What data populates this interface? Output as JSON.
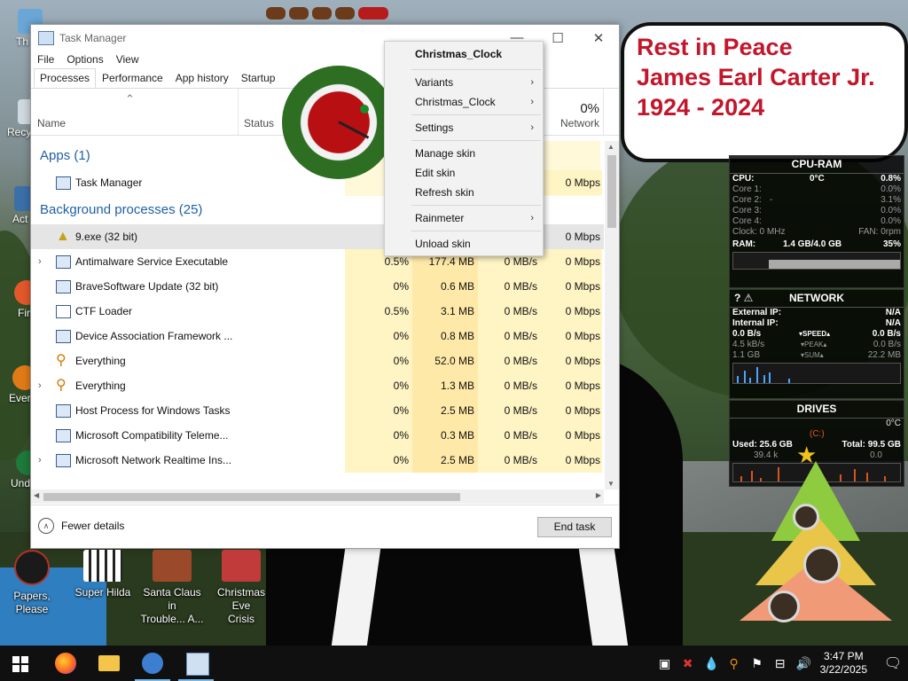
{
  "desktop": {
    "left_stubs": [
      "Th",
      "Recy",
      "Act",
      "Fir",
      "Ever",
      "Und"
    ],
    "shortcuts": [
      {
        "label_1": "Papers, Please",
        "label_2": ""
      },
      {
        "label_1": "Super Hilda",
        "label_2": ""
      },
      {
        "label_1": "Santa Claus in",
        "label_2": "Trouble... A..."
      },
      {
        "label_1": "Christmas Eve",
        "label_2": "Crisis"
      }
    ]
  },
  "task_manager": {
    "title": "Task Manager",
    "menu": [
      "File",
      "Options",
      "View"
    ],
    "tabs": [
      "Processes",
      "Performance",
      "App history",
      "Startup"
    ],
    "columns": {
      "name": "Name",
      "status": "Status",
      "network_pct": "0%",
      "network": "Network"
    },
    "groups": {
      "apps": "Apps (1)",
      "background": "Background processes (25)"
    },
    "app_rows": [
      {
        "name": "Task Manager",
        "cpu": "",
        "mem": "",
        "disk": "",
        "net": "0 Mbps"
      }
    ],
    "bg_rows": [
      {
        "name": "9.exe (32 bit)",
        "cpu": "",
        "mem": "",
        "disk": "",
        "net": "0 Mbps",
        "expand": false,
        "icon": "xmas-tree-icon"
      },
      {
        "name": "Antimalware Service Executable",
        "cpu": "0.5%",
        "mem": "177.4 MB",
        "disk": "0 MB/s",
        "net": "0 Mbps",
        "expand": true,
        "icon": "service-icon"
      },
      {
        "name": "BraveSoftware Update (32 bit)",
        "cpu": "0%",
        "mem": "0.6 MB",
        "disk": "0 MB/s",
        "net": "0 Mbps",
        "expand": false,
        "icon": "update-icon"
      },
      {
        "name": "CTF Loader",
        "cpu": "0.5%",
        "mem": "3.1 MB",
        "disk": "0 MB/s",
        "net": "0 Mbps",
        "expand": false,
        "icon": "pen-icon"
      },
      {
        "name": "Device Association Framework ...",
        "cpu": "0%",
        "mem": "0.8 MB",
        "disk": "0 MB/s",
        "net": "0 Mbps",
        "expand": false,
        "icon": "service-icon"
      },
      {
        "name": "Everything",
        "cpu": "0%",
        "mem": "52.0 MB",
        "disk": "0 MB/s",
        "net": "0 Mbps",
        "expand": false,
        "icon": "search-key-icon"
      },
      {
        "name": "Everything",
        "cpu": "0%",
        "mem": "1.3 MB",
        "disk": "0 MB/s",
        "net": "0 Mbps",
        "expand": true,
        "icon": "search-key-icon"
      },
      {
        "name": "Host Process for Windows Tasks",
        "cpu": "0%",
        "mem": "2.5 MB",
        "disk": "0 MB/s",
        "net": "0 Mbps",
        "expand": false,
        "icon": "service-icon"
      },
      {
        "name": "Microsoft Compatibility Teleme...",
        "cpu": "0%",
        "mem": "0.3 MB",
        "disk": "0 MB/s",
        "net": "0 Mbps",
        "expand": false,
        "icon": "service-icon"
      },
      {
        "name": "Microsoft Network Realtime Ins...",
        "cpu": "0%",
        "mem": "2.5 MB",
        "disk": "0 MB/s",
        "net": "0 Mbps",
        "expand": true,
        "icon": "service-icon"
      }
    ],
    "fewer_details": "Fewer details",
    "end_task": "End task"
  },
  "context_menu": {
    "header": "Christmas_Clock",
    "items": [
      {
        "label": "Variants",
        "submenu": true
      },
      {
        "label": "Christmas_Clock",
        "submenu": true
      },
      {
        "label": "Settings",
        "submenu": true
      },
      {
        "label": "Manage skin",
        "submenu": false
      },
      {
        "label": "Edit skin",
        "submenu": false
      },
      {
        "label": "Refresh skin",
        "submenu": false
      },
      {
        "label": "Rainmeter",
        "submenu": true
      },
      {
        "label": "Unload skin",
        "submenu": false
      }
    ]
  },
  "memorial": {
    "line1": "Rest in Peace",
    "line2": "James Earl Carter Jr.",
    "line3": "1924 - 2024"
  },
  "cpu_ram": {
    "title": "CPU-RAM",
    "cpu_label": "CPU:",
    "cpu_temp": "0°C",
    "cpu_pct": "0.8%",
    "cores": [
      {
        "label": "Core 1:",
        "mid": "",
        "val": "0.0%"
      },
      {
        "label": "Core 2:",
        "mid": "-",
        "val": "3.1%"
      },
      {
        "label": "Core 3:",
        "mid": "",
        "val": "0.0%"
      },
      {
        "label": "Core 4:",
        "mid": "",
        "val": "0.0%"
      }
    ],
    "clock": "Clock: 0 MHz",
    "fan": "FAN: 0rpm",
    "ram_label": "RAM:",
    "ram_val": "1.4 GB/4.0 GB",
    "ram_pct": "35%"
  },
  "network": {
    "title": "NETWORK",
    "ext_label": "External IP:",
    "ext_val": "N/A",
    "int_label": "Internal IP:",
    "int_val": "N/A",
    "rows": [
      {
        "left": "0.0 B/s",
        "mid": "▾SPEED▴",
        "right": "0.0 B/s",
        "bold": true
      },
      {
        "left": "4.5 kB/s",
        "mid": "▾PEAK▴",
        "right": "0.0 B/s",
        "bold": false
      },
      {
        "left": "1.1 GB",
        "mid": "▾SUM▴",
        "right": "22.2 MB",
        "bold": false
      }
    ]
  },
  "drives": {
    "title": "DRIVES",
    "temp": "0°C",
    "drive": "(C:)",
    "used": "Used: 25.6 GB",
    "total": "Total: 99.5 GB",
    "read": "39.4 k",
    "write": "0.0"
  },
  "taskbar": {
    "time": "3:47 PM",
    "date": "3/22/2025"
  }
}
